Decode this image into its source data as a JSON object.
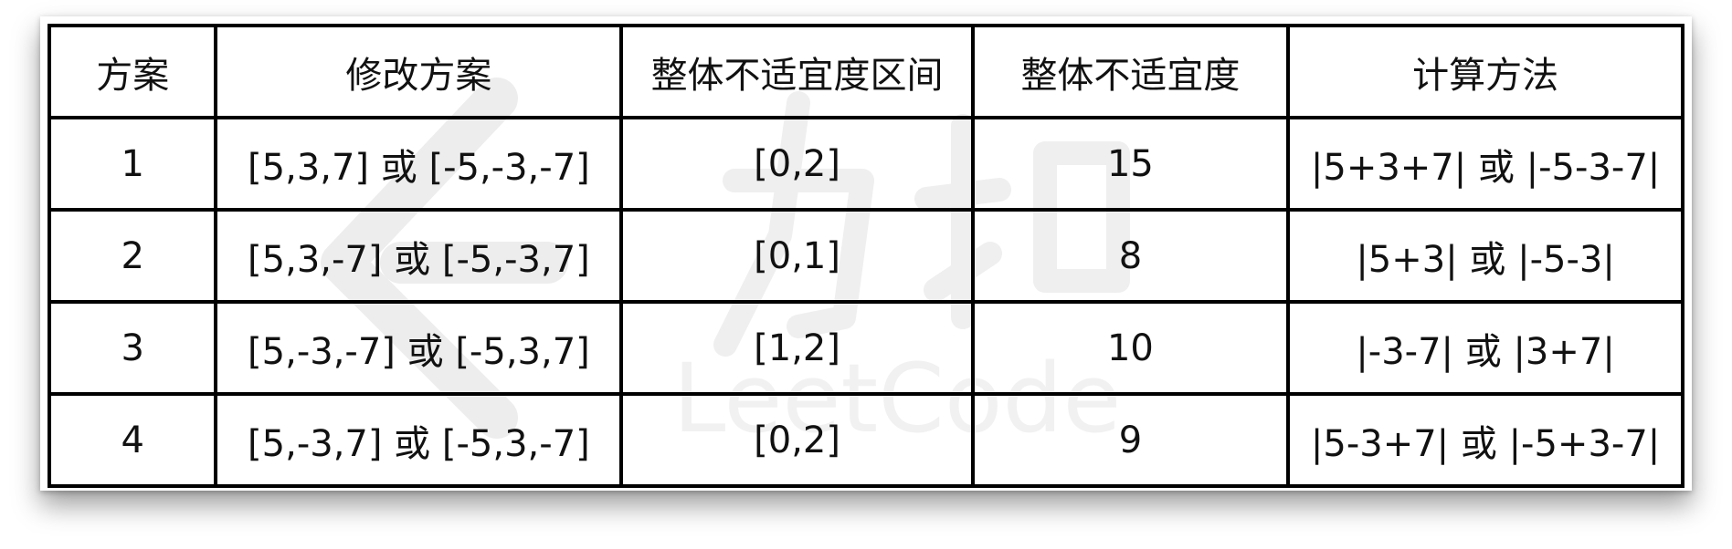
{
  "watermark": {
    "text": "LeetCode",
    "icon": "leetcode-logo"
  },
  "table": {
    "headers": [
      "方案",
      "修改方案",
      "整体不适宜度区间",
      "整体不适宜度",
      "计算方法"
    ],
    "rows": [
      [
        "1",
        "[5,3,7] 或 [-5,-3,-7]",
        "[0,2]",
        "15",
        "|5+3+7| 或 |-5-3-7|"
      ],
      [
        "2",
        "[5,3,-7] 或 [-5,-3,7]",
        "[0,1]",
        "8",
        "|5+3| 或 |-5-3|"
      ],
      [
        "3",
        "[5,-3,-7] 或 [-5,3,7]",
        "[1,2]",
        "10",
        "|-3-7| 或 |3+7|"
      ],
      [
        "4",
        "[5,-3,7] 或 [-5,3,-7]",
        "[0,2]",
        "9",
        "|5-3+7| 或 |-5+3-7|"
      ]
    ]
  },
  "colors": {
    "border": "#000000",
    "text": "#111111",
    "watermark": "#ececec"
  }
}
